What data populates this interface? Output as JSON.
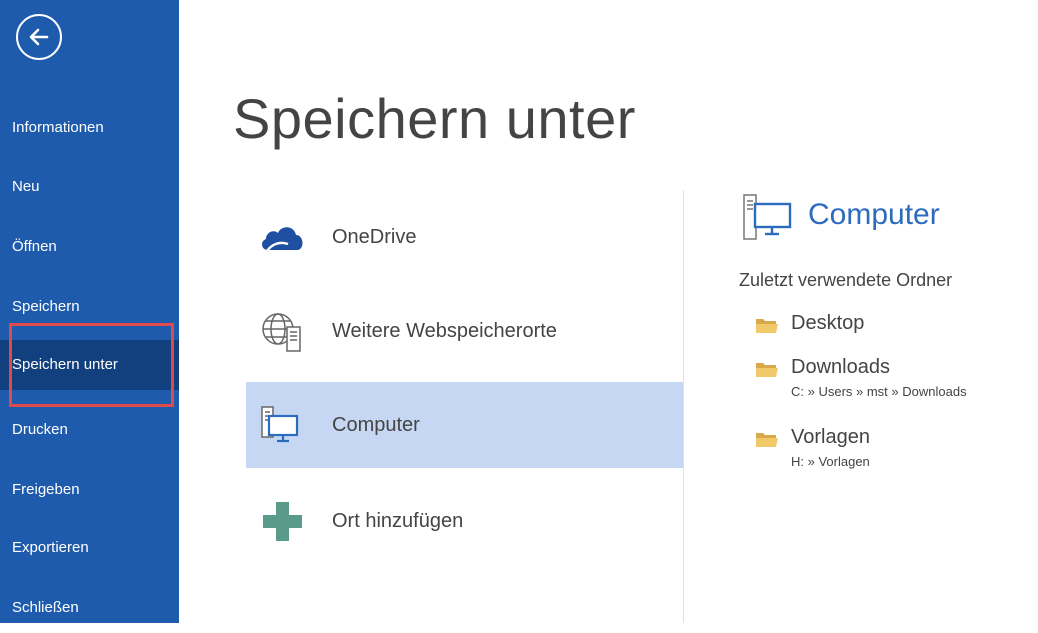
{
  "sidebar": {
    "back_label": "",
    "items": [
      {
        "label": "Informationen"
      },
      {
        "label": "Neu"
      },
      {
        "label": "Öffnen"
      },
      {
        "label": "Speichern"
      },
      {
        "label": "Speichern unter",
        "active": true
      },
      {
        "label": "Drucken"
      },
      {
        "label": "Freigeben"
      },
      {
        "label": "Exportieren"
      },
      {
        "label": "Schließen"
      }
    ]
  },
  "main": {
    "title": "Speichern unter",
    "places": [
      {
        "label": "OneDrive",
        "icon": "cloud-icon"
      },
      {
        "label": "Weitere Webspeicherorte",
        "icon": "globe-server-icon"
      },
      {
        "label": "Computer",
        "icon": "computer-icon",
        "selected": true
      },
      {
        "label": "Ort hinzufügen",
        "icon": "plus-icon"
      }
    ]
  },
  "right_pane": {
    "title": "Computer",
    "recent_heading": "Zuletzt verwendete Ordner",
    "folders": [
      {
        "name": "Desktop",
        "path": ""
      },
      {
        "name": "Downloads",
        "path": "C: » Users » mst » Downloads"
      },
      {
        "name": "Vorlagen",
        "path": "H: » Vorlagen"
      }
    ]
  },
  "colors": {
    "sidebar": "#1f5bad",
    "sidebar_active": "#123f7d",
    "selection": "#c5d7f2",
    "accent": "#2c6bbd",
    "highlight": "#e04a4a"
  }
}
